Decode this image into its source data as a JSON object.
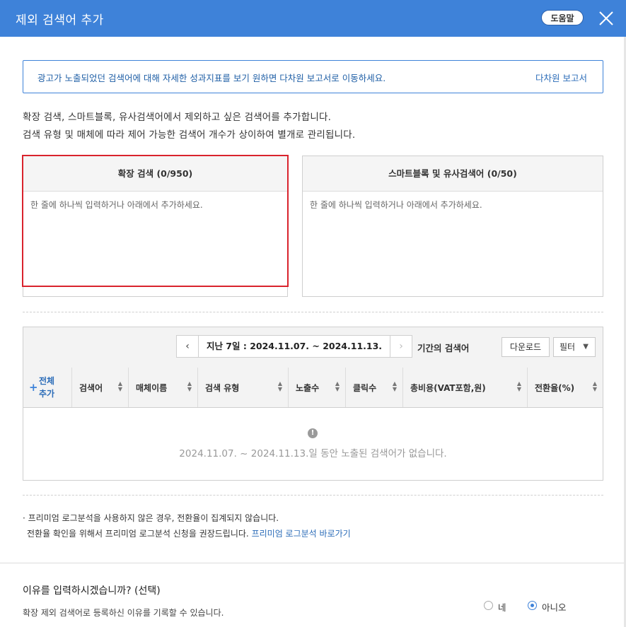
{
  "dialog": {
    "title": "제외 검색어 추가",
    "help_label": "도움말"
  },
  "info": {
    "message": "광고가 노출되었던 검색어에 대해 자세한 성과지표를 보기 원하면 다차원 보고서로 이동하세요.",
    "link": "다차원 보고서"
  },
  "description": {
    "line1": "확장 검색, 스마트블록, 유사검색어에서 제외하고 싶은 검색어를 추가합니다.",
    "line2": "검색 유형 및 매체에 따라 제어 가능한 검색어 개수가 상이하여 별개로 관리됩니다."
  },
  "panels": {
    "expanded": {
      "header": "확장 검색 (0/950)",
      "placeholder": "한 줄에 하나씩 입력하거나 아래에서 추가하세요."
    },
    "smartblock": {
      "header": "스마트블록 및 유사검색어 (0/50)",
      "placeholder": "한 줄에 하나씩 입력하거나 아래에서 추가하세요."
    }
  },
  "toolbar": {
    "prev": "‹",
    "next": "›",
    "date_range": "지난 7일 : 2024.11.07. ~ 2024.11.13.",
    "period_label": "기간의 검색어",
    "download": "다운로드",
    "filter": "필터"
  },
  "table": {
    "add_all_line1": "전체",
    "add_all_line2": "추가",
    "columns": [
      "검색어",
      "매체이름",
      "검색 유형",
      "노출수",
      "클릭수",
      "총비용(VAT포함,원)",
      "전환율(%)"
    ],
    "empty_message": "2024.11.07. ~ 2024.11.13.일 동안 노출된 검색어가 없습니다."
  },
  "notes": {
    "line1": "· 프리미엄 로그분석을 사용하지 않은 경우, 전환율이 집계되지 않습니다.",
    "line2": "전환율 확인을 위해서 프리미엄 로그분석 신청을 권장드립니다.",
    "link": "프리미엄 로그분석 바로가기"
  },
  "reason": {
    "title": "이유를 입력하시겠습니까? (선택)",
    "desc": "확장 제외 검색어로 등록하신 이유를 기록할 수 있습니다.",
    "options": [
      "네",
      "아니오"
    ],
    "selected": "아니오"
  },
  "colors": {
    "header_blue": "#3e82d9",
    "link_blue": "#2b6cb8",
    "highlight_red": "#d9232d"
  }
}
